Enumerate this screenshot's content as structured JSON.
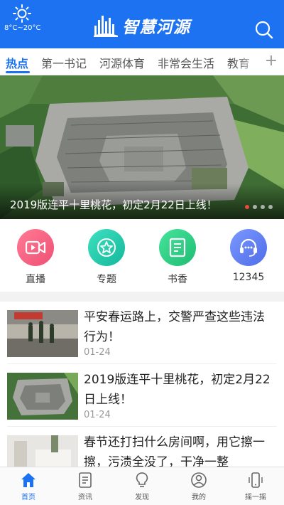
{
  "header": {
    "temperature": "8°C~20°C",
    "app_title": "智慧河源",
    "weather_icon": "sun-icon",
    "brand_color": "#1c72f0"
  },
  "tabs": [
    {
      "label": "热点",
      "active": true
    },
    {
      "label": "第一书记"
    },
    {
      "label": "河源体育"
    },
    {
      "label": "非常会生活"
    },
    {
      "label": "教育"
    }
  ],
  "tab_add": "+",
  "banner": {
    "title": "2019版连平十里桃花，初定2月22日上线！",
    "slide_count": 4,
    "active_slide": 1
  },
  "quick": [
    {
      "label": "直播",
      "icon": "video-camera-icon",
      "color": "#f0577a"
    },
    {
      "label": "专题",
      "icon": "star-icon",
      "color": "#1ec7a9"
    },
    {
      "label": "书香",
      "icon": "book-icon",
      "color": "#2fd08a"
    },
    {
      "label": "12345",
      "icon": "headset-icon",
      "color": "#5b7cf0"
    }
  ],
  "news": [
    {
      "title": "平安春运路上，交警严查这些违法行为！",
      "date": "01-24"
    },
    {
      "title": "2019版连平十里桃花，初定2月22日上线！",
      "date": "01-24"
    },
    {
      "title": "春节还打扫什么房间啊，用它擦一擦，污渍全没了，干净一整",
      "date": ""
    }
  ],
  "nav": [
    {
      "label": "首页",
      "icon": "home-icon",
      "active": true
    },
    {
      "label": "资讯",
      "icon": "news-icon"
    },
    {
      "label": "发现",
      "icon": "lightbulb-icon"
    },
    {
      "label": "我的",
      "icon": "user-icon"
    },
    {
      "label": "摇一摇",
      "icon": "phone-shake-icon"
    }
  ]
}
